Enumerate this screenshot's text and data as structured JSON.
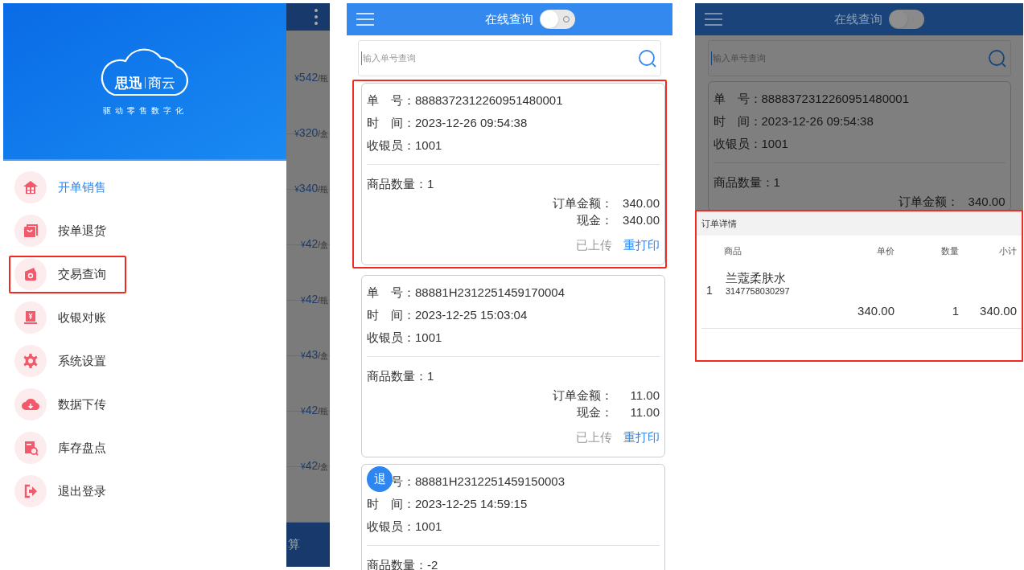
{
  "screen_1": {
    "background_prices": [
      {
        "currency": "¥",
        "amount": "542",
        "unit": "/瓶"
      },
      {
        "currency": "¥",
        "amount": "320",
        "unit": "/盒"
      },
      {
        "currency": "¥",
        "amount": "340",
        "unit": "/瓶"
      },
      {
        "currency": "¥",
        "amount": "42",
        "unit": "/盒"
      },
      {
        "currency": "¥",
        "amount": "42",
        "unit": "/瓶"
      },
      {
        "currency": "¥",
        "amount": "43",
        "unit": "/盒"
      },
      {
        "currency": "¥",
        "amount": "42",
        "unit": "/瓶"
      },
      {
        "currency": "¥",
        "amount": "42",
        "unit": "/盒"
      }
    ],
    "background_button": "算",
    "drawer": {
      "logo": {
        "brand_left": "思迅",
        "brand_right": "商云",
        "slogan": "驱动零售数字化"
      },
      "items": [
        {
          "label": "开单销售",
          "selected": true,
          "highlighted": false
        },
        {
          "label": "按单退货",
          "selected": false,
          "highlighted": false
        },
        {
          "label": "交易查询",
          "selected": false,
          "highlighted": true
        },
        {
          "label": "收银对账",
          "selected": false,
          "highlighted": false
        },
        {
          "label": "系统设置",
          "selected": false,
          "highlighted": false
        },
        {
          "label": "数据下传",
          "selected": false,
          "highlighted": false
        },
        {
          "label": "库存盘点",
          "selected": false,
          "highlighted": false
        },
        {
          "label": "退出登录",
          "selected": false,
          "highlighted": false
        }
      ]
    }
  },
  "screen_2": {
    "title": "在线查询",
    "online_toggle": {
      "on": false
    },
    "search": {
      "placeholder": "输入单号查询"
    },
    "orders": [
      {
        "highlighted": true,
        "order_no_label": "单　号：",
        "order_no": "8888372312260951480001",
        "time_label": "时　间：",
        "time": "2023-12-26 09:54:38",
        "cashier_label": "收银员：",
        "cashier": "1001",
        "qty_label": "商品数量：",
        "qty": "1",
        "amount_label": "订单金额：",
        "amount": "340.00",
        "cash_label": "现金：",
        "cash": "340.00",
        "status": "已上传",
        "reprint": "重打印"
      },
      {
        "highlighted": false,
        "order_no_label": "单　号：",
        "order_no": "88881H2312251459170004",
        "time_label": "时　间：",
        "time": "2023-12-25 15:03:04",
        "cashier_label": "收银员：",
        "cashier": "1001",
        "qty_label": "商品数量：",
        "qty": "1",
        "amount_label": "订单金额：",
        "amount": "11.00",
        "cash_label": "现金：",
        "cash": "11.00",
        "status": "已上传",
        "reprint": "重打印"
      },
      {
        "highlighted": false,
        "return_badge": "退",
        "order_no_label": "号：",
        "order_no": "88881H2312251459150003",
        "time_label": "时　间：",
        "time": "2023-12-25 14:59:15",
        "cashier_label": "收银员：",
        "cashier": "1001",
        "qty_label": "商品数量：",
        "qty": "-2"
      }
    ]
  },
  "screen_3": {
    "title": "在线查询",
    "online_toggle": {
      "on": false
    },
    "search": {
      "placeholder": "输入单号查询"
    },
    "order": {
      "order_no_label": "单　号：",
      "order_no": "8888372312260951480001",
      "time_label": "时　间：",
      "time": "2023-12-26 09:54:38",
      "cashier_label": "收银员：",
      "cashier": "1001",
      "qty_label": "商品数量：",
      "qty": "1",
      "amount_label": "订单金额：",
      "amount": "340.00"
    },
    "detail_sheet": {
      "title": "订单详情",
      "highlighted": true,
      "columns": [
        "商品",
        "单价",
        "数量",
        "小计"
      ],
      "rows": [
        {
          "index": "1",
          "name": "兰蔻柔肤水",
          "barcode": "3147758030297",
          "price": "340.00",
          "qty": "1",
          "subtotal": "340.00"
        }
      ]
    }
  }
}
